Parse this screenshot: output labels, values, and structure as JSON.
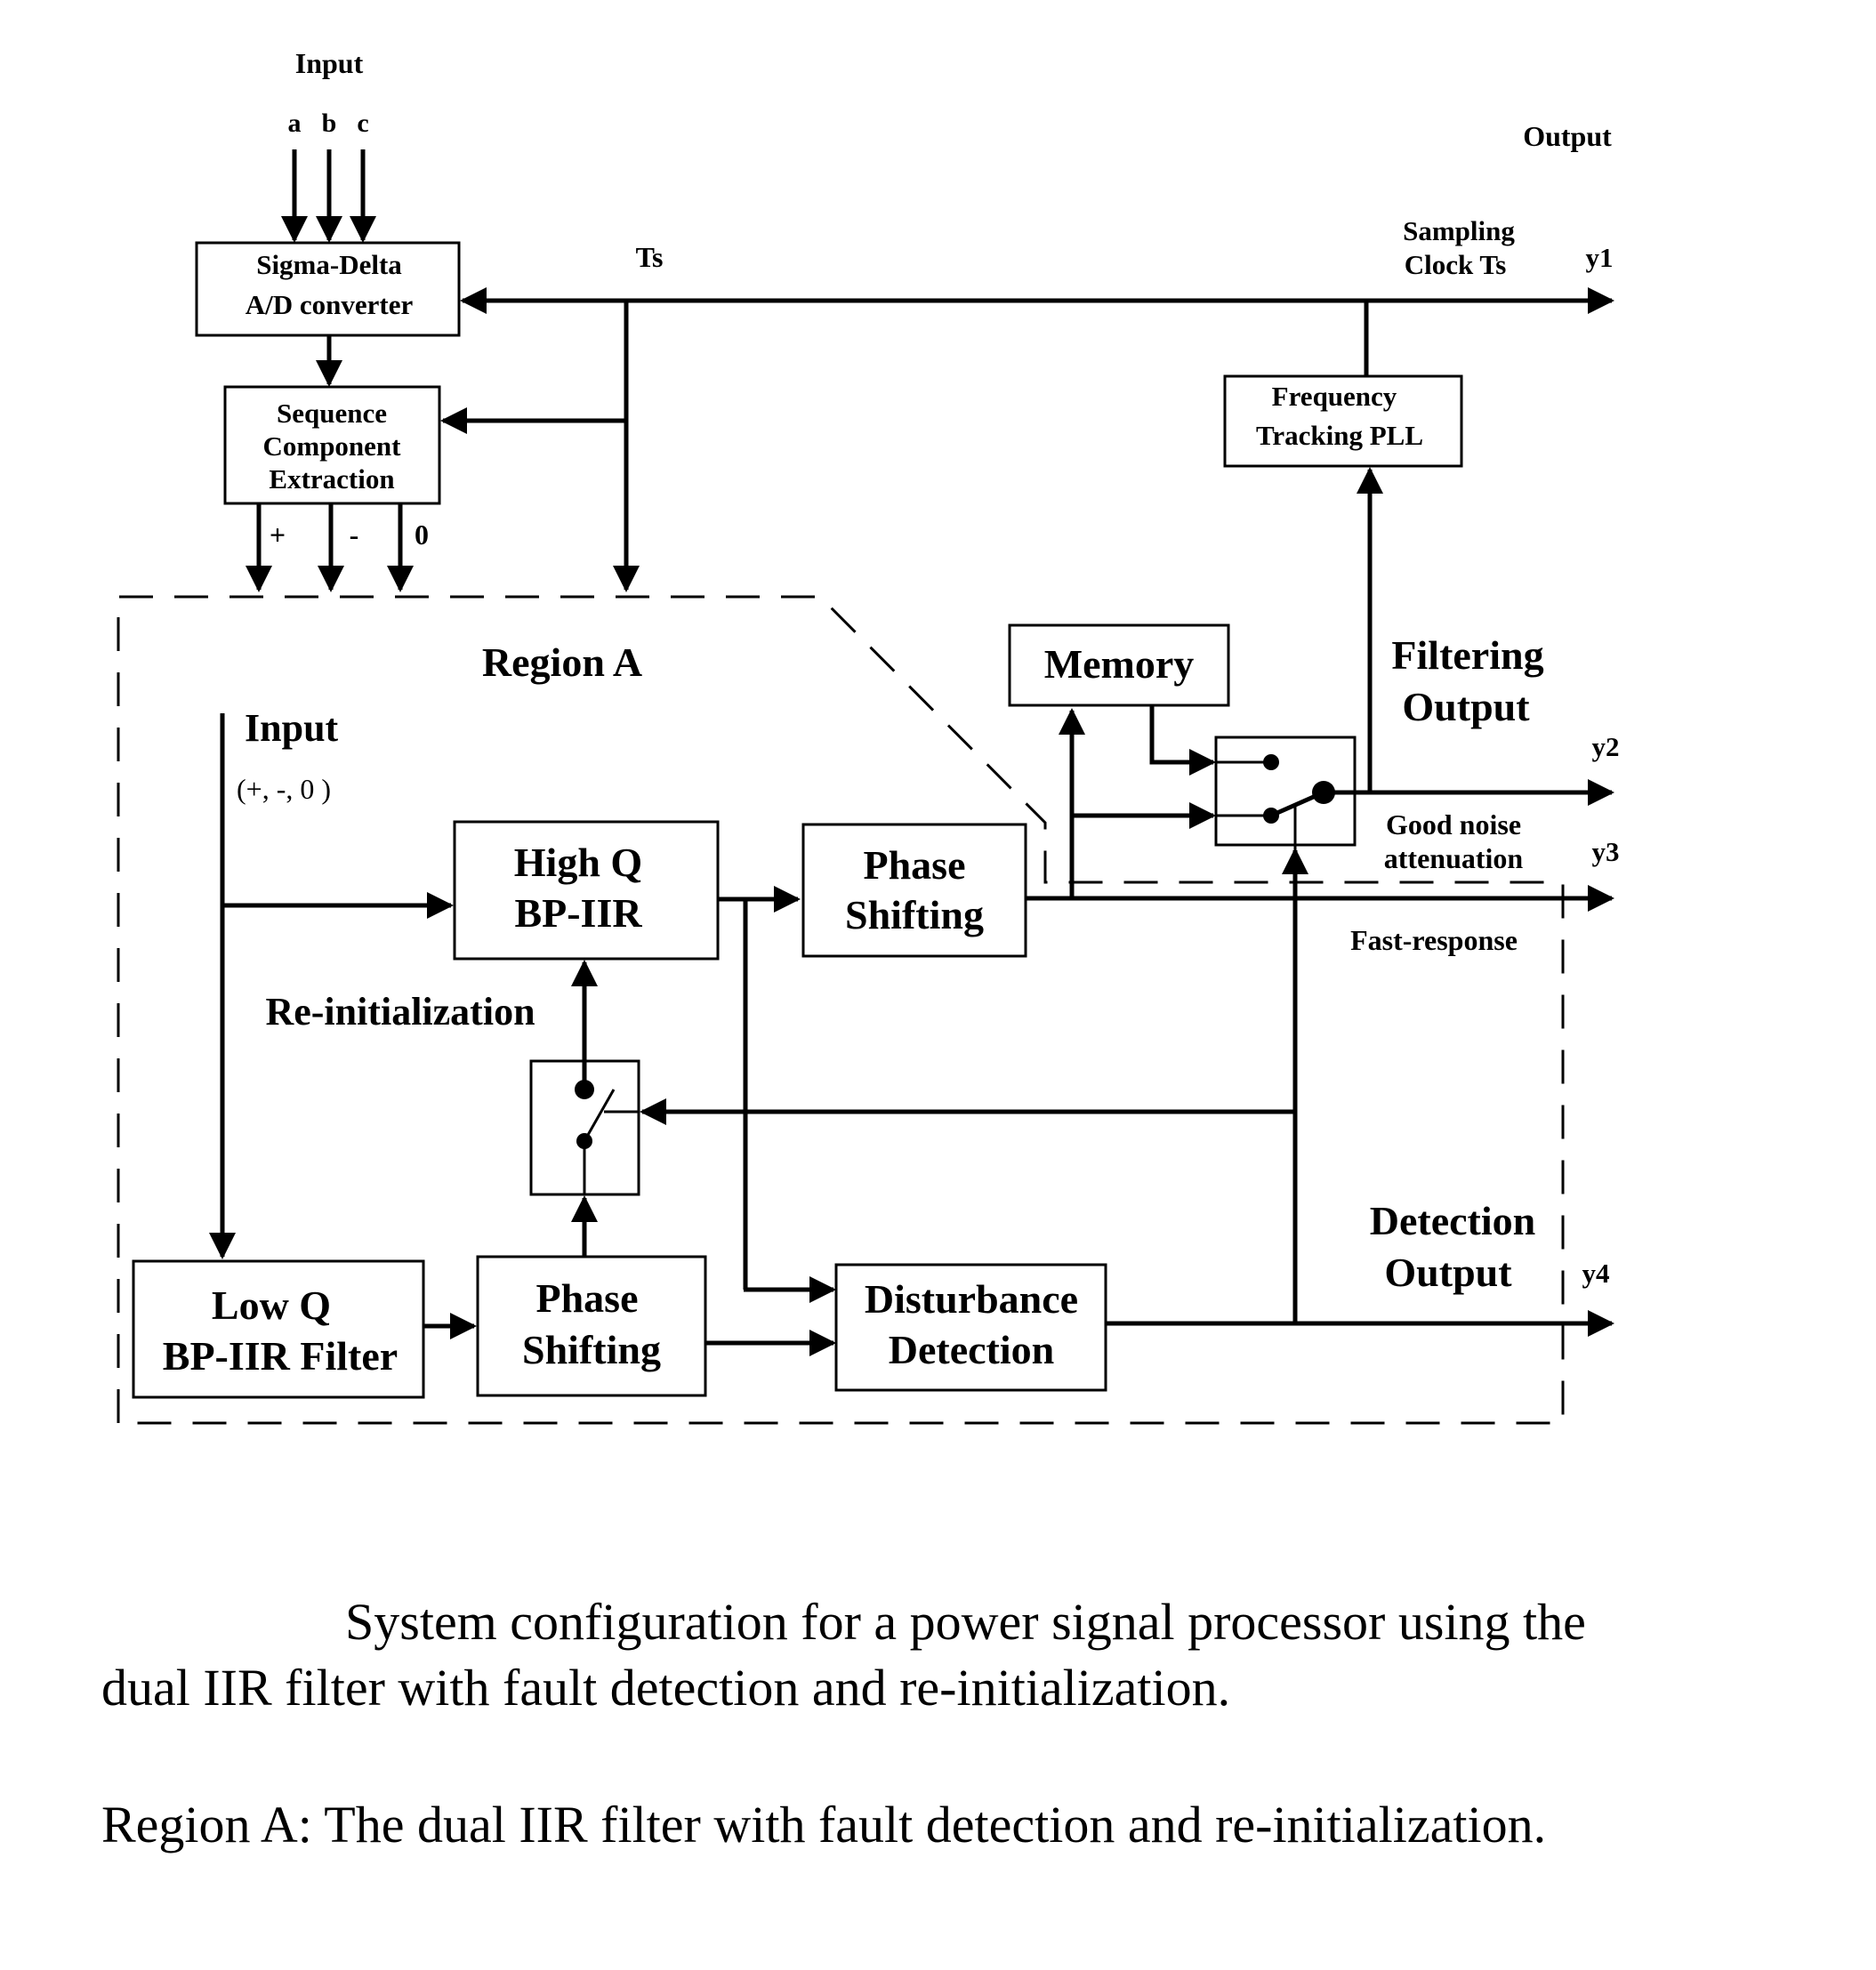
{
  "diagram": {
    "input_header": "Input",
    "phases": [
      "a",
      "b",
      "c"
    ],
    "output_header": "Output",
    "ts_label": "Ts",
    "sampling_clock_label": [
      "Sampling",
      "Clock Ts"
    ],
    "blocks": {
      "adc": [
        "Sigma-Delta",
        "A/D converter"
      ],
      "sequence": [
        "Sequence",
        "Component",
        "Extraction"
      ],
      "pll": [
        "Frequency",
        "Tracking PLL"
      ],
      "memory": [
        "Memory"
      ],
      "high_q": [
        "High Q",
        "BP-IIR"
      ],
      "phase_shift_upper": [
        "Phase",
        "Shifting"
      ],
      "low_q": [
        "Low Q",
        "BP-IIR Filter"
      ],
      "phase_shift_lower": [
        "Phase",
        "Shifting"
      ],
      "disturbance": [
        "Disturbance",
        "Detection"
      ]
    },
    "sequence_outputs": [
      "+",
      "-",
      "0"
    ],
    "region_label": "Region A",
    "region_input": [
      "Input",
      "(+, -, 0 )"
    ],
    "reinit_label": "Re-initialization",
    "filtering_output": [
      "Filtering",
      "Output"
    ],
    "good_noise": [
      "Good noise",
      "attenuation"
    ],
    "fast_response": "Fast-response",
    "detection_output": [
      "Detection",
      "Output"
    ],
    "outputs": [
      "y1",
      "y2",
      "y3",
      "y4"
    ]
  },
  "caption": {
    "line1": "System configuration for a power signal processor using the",
    "line2": "dual IIR filter with fault detection and re-initialization.",
    "line3": "Region A: The dual IIR filter with fault detection and re-initialization."
  }
}
